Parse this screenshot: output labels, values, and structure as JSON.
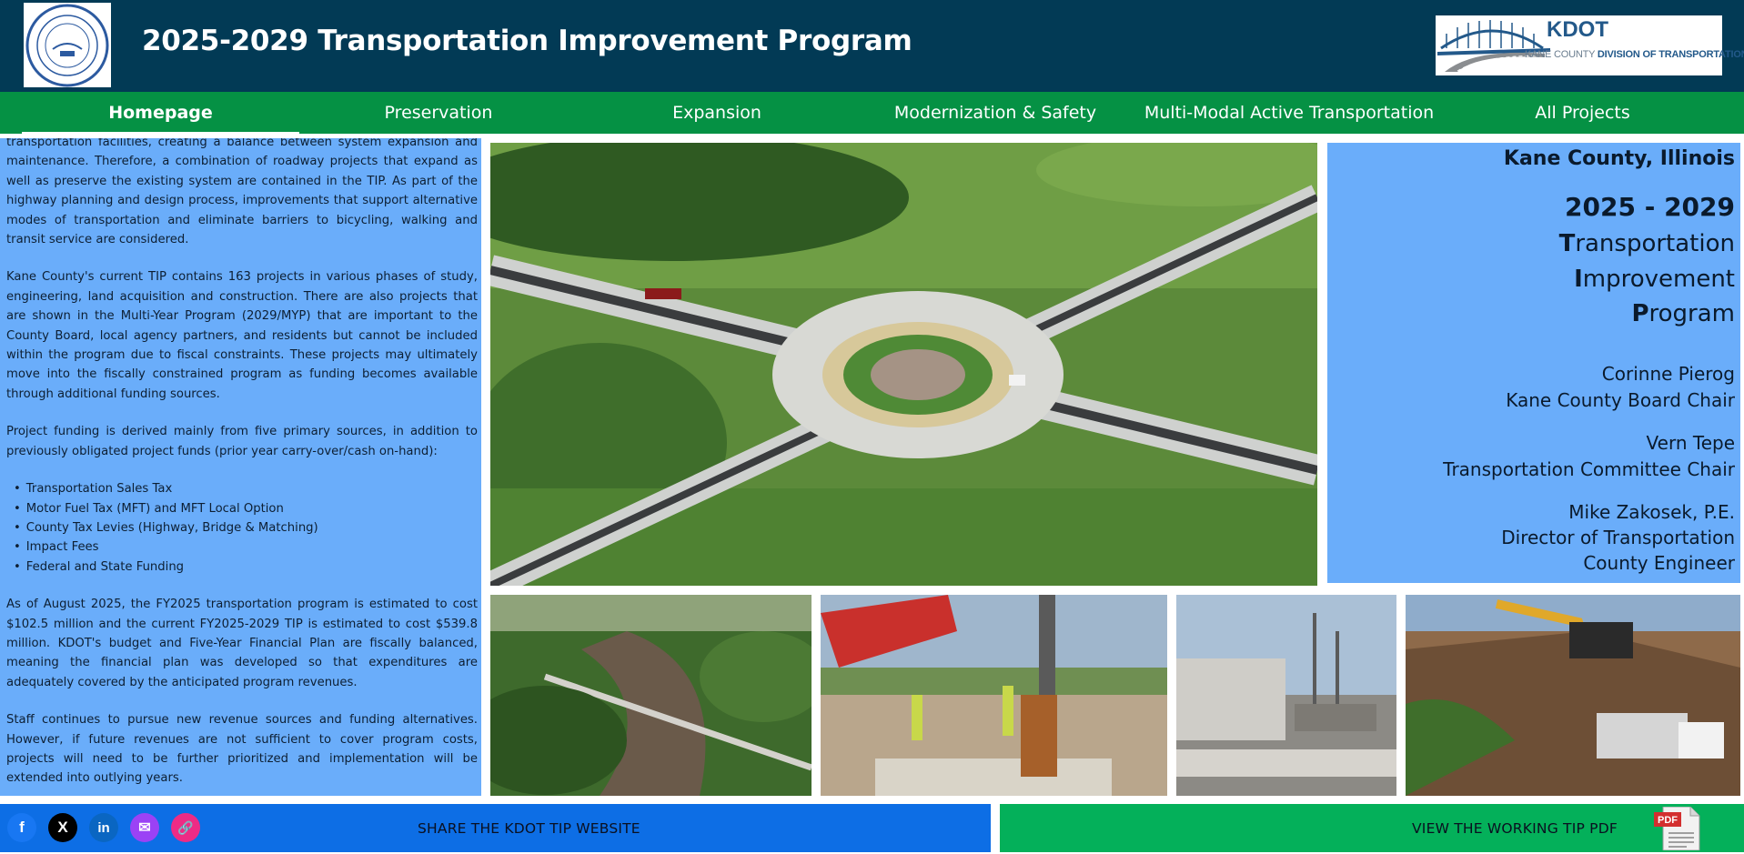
{
  "header": {
    "title": "2025-2029 Transportation Improvement Program",
    "seal_text": "SEAL OF THE COUNTY OF KANE · STATE OF ILLINOIS",
    "seal_center": "ORGANIZED JAN. 16, 1836",
    "kdot_name": "KDOT",
    "kdot_sub_prefix": "KANE COUNTY ",
    "kdot_sub_bold": "DIVISION OF TRANSPORTATION"
  },
  "nav": {
    "items": [
      {
        "label": "Homepage",
        "active": true
      },
      {
        "label": "Preservation"
      },
      {
        "label": "Expansion"
      },
      {
        "label": "Modernization & Safety"
      },
      {
        "label": "Multi-Modal Active Transportation"
      },
      {
        "label": "All Projects"
      }
    ]
  },
  "intro": {
    "p1": "transportation facilities, creating a balance between system expansion and maintenance. Therefore, a combination of roadway projects that expand as well as preserve the existing system are contained in the TIP. As part of the highway planning and design process, improvements that support alternative modes of transportation and eliminate barriers to bicycling, walking and transit service are considered.",
    "p2": "Kane County's current TIP contains 163 projects in various phases of study, engineering, land acquisition and construction. There are also projects that are shown in the Multi-Year Program (2029/MYP) that are important to the County Board, local agency partners, and residents but cannot be included within the program due to fiscal constraints. These projects may ultimately move into the fiscally constrained program as funding becomes available through additional funding sources.",
    "p3": "Project funding is derived mainly from five primary sources, in addition to previously obligated project funds (prior year carry-over/cash on-hand):",
    "sources": [
      "Transportation Sales Tax",
      "Motor Fuel Tax (MFT) and MFT Local Option",
      "County Tax Levies (Highway, Bridge & Matching)",
      "Impact Fees",
      "Federal and State Funding"
    ],
    "p4": "As of August 2025, the FY2025 transportation program is estimated to cost $102.5 million and the current FY2025-2029 TIP is estimated to cost $539.8 million. KDOT's budget and Five-Year Financial Plan are fiscally balanced, meaning the financial plan was developed so that expenditures are adequately covered by the anticipated program revenues.",
    "p5": "Staff continues to pursue new revenue sources and funding alternatives. However, if future revenues are not sufficient to cover program costs, projects will need to be further prioritized and implementation will be extended into outlying years."
  },
  "sidebar": {
    "county": "Kane County, Illinois",
    "years": "2025 - 2029",
    "words": [
      {
        "first": "T",
        "rest": "ransportation"
      },
      {
        "first": "I",
        "rest": "mprovement"
      },
      {
        "first": "P",
        "rest": "rogram"
      }
    ],
    "officials": [
      {
        "name": "Corinne Pierog",
        "title": "Kane County Board Chair"
      },
      {
        "name": "Vern Tepe",
        "title": "Transportation Committee Chair"
      },
      {
        "name": "Mike Zakosek, P.E.",
        "title": "Director of Transportation",
        "title2": "County Engineer"
      }
    ]
  },
  "footer": {
    "share_label": "SHARE THE KDOT TIP WEBSITE",
    "pdf_label": "VIEW THE WORKING TIP PDF",
    "pdf_icon_text": "PDF",
    "social": [
      {
        "name": "facebook",
        "glyph": "f",
        "color": "#1877f2"
      },
      {
        "name": "x",
        "glyph": "X",
        "color": "#000000"
      },
      {
        "name": "linkedin",
        "glyph": "in",
        "color": "#0a66c2"
      },
      {
        "name": "email",
        "glyph": "✉",
        "color": "#9b42f5"
      },
      {
        "name": "copy-link",
        "glyph": "🔗",
        "color": "#ee2b85"
      }
    ]
  },
  "colors": {
    "header_bg": "#023a55",
    "nav_bg": "#059144",
    "panel_blue": "#6aadfa",
    "share_bg": "#0d6ee5",
    "pdf_bg": "#04b05a"
  }
}
